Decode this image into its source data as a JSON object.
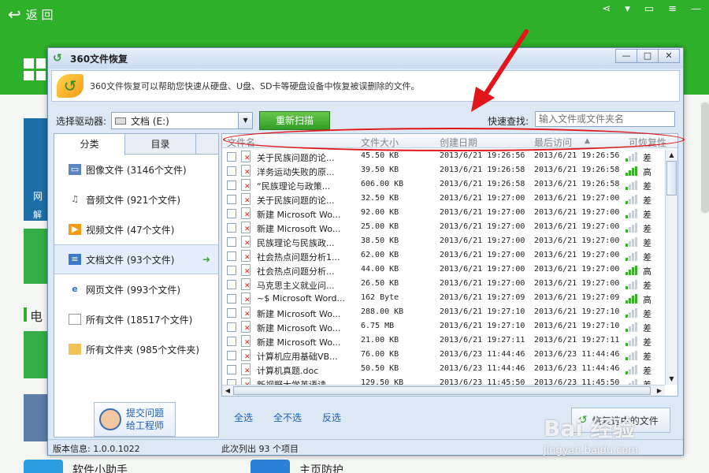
{
  "bg": {
    "back_label": "返 回",
    "tile_wang": "网",
    "tile_jie": "解",
    "section_dian": "电",
    "bottom_items": [
      "软件小助手",
      "主页防护"
    ],
    "top_icons": [
      "share-icon",
      "skin-icon",
      "message-icon",
      "menu-icon",
      "minimize-icon"
    ]
  },
  "dialog": {
    "title": "360文件恢复",
    "window_buttons": [
      "—",
      "□",
      "✕"
    ],
    "info_text": "360文件恢复可以帮助您快速从硬盘、U盘、SD卡等硬盘设备中恢复被误删除的文件。",
    "drive_label": "选择驱动器:",
    "drive_value": "文档 (E:)",
    "rescan_label": "重新扫描",
    "search_label": "快速查找:",
    "search_placeholder": "输入文件或文件夹名",
    "tabs": [
      "分类",
      "目录"
    ],
    "categories": [
      {
        "label": "图像文件 (3146个文件)",
        "icon": "image-file-icon"
      },
      {
        "label": "音频文件 (921个文件)",
        "icon": "audio-file-icon"
      },
      {
        "label": "视频文件 (47个文件)",
        "icon": "video-file-icon"
      },
      {
        "label": "文档文件 (93个文件)",
        "icon": "document-file-icon"
      },
      {
        "label": "网页文件 (993个文件)",
        "icon": "web-file-icon"
      },
      {
        "label": "所有文件 (18517个文件)",
        "icon": "all-files-icon"
      },
      {
        "label": "所有文件夹 (985个文件夹)",
        "icon": "folder-icon"
      }
    ],
    "help_line1": "提交问题",
    "help_line2": "给工程师",
    "columns": {
      "name": "文件名",
      "size": "文件大小",
      "created": "创建日期",
      "accessed": "最后访问",
      "sort_mark": "▲",
      "recoverable": "可恢复性"
    },
    "files": [
      {
        "name": "关于民族问题的论...",
        "size": "45.50 KB",
        "created": "2013/6/21 19:26:56",
        "accessed": "2013/6/21 19:26:56",
        "rec": "差"
      },
      {
        "name": "洋务运动失败的原...",
        "size": "39.50 KB",
        "created": "2013/6/21 19:26:58",
        "accessed": "2013/6/21 19:26:58",
        "rec": "高"
      },
      {
        "name": "“民族理论与政策...",
        "size": "606.00 KB",
        "created": "2013/6/21 19:26:58",
        "accessed": "2013/6/21 19:26:58",
        "rec": "差"
      },
      {
        "name": "关于民族问题的论...",
        "size": "32.50 KB",
        "created": "2013/6/21 19:27:00",
        "accessed": "2013/6/21 19:27:00",
        "rec": "差"
      },
      {
        "name": "新建 Microsoft Wo...",
        "size": "92.00 KB",
        "created": "2013/6/21 19:27:00",
        "accessed": "2013/6/21 19:27:00",
        "rec": "差"
      },
      {
        "name": "新建 Microsoft Wo...",
        "size": "25.00 KB",
        "created": "2013/6/21 19:27:00",
        "accessed": "2013/6/21 19:27:00",
        "rec": "差"
      },
      {
        "name": "民族理论与民族政...",
        "size": "38.50 KB",
        "created": "2013/6/21 19:27:00",
        "accessed": "2013/6/21 19:27:00",
        "rec": "差"
      },
      {
        "name": "社会热点问题分析1...",
        "size": "62.00 KB",
        "created": "2013/6/21 19:27:00",
        "accessed": "2013/6/21 19:27:00",
        "rec": "差"
      },
      {
        "name": "社会热点问题分析...",
        "size": "44.00 KB",
        "created": "2013/6/21 19:27:00",
        "accessed": "2013/6/21 19:27:00",
        "rec": "高"
      },
      {
        "name": "马克思主义就业问...",
        "size": "26.50 KB",
        "created": "2013/6/21 19:27:00",
        "accessed": "2013/6/21 19:27:00",
        "rec": "差"
      },
      {
        "name": "~$ Microsoft Word...",
        "size": "162 Byte",
        "created": "2013/6/21 19:27:09",
        "accessed": "2013/6/21 19:27:09",
        "rec": "高"
      },
      {
        "name": "新建 Microsoft Wo...",
        "size": "288.00 KB",
        "created": "2013/6/21 19:27:10",
        "accessed": "2013/6/21 19:27:10",
        "rec": "差"
      },
      {
        "name": "新建 Microsoft Wo...",
        "size": "6.75 MB",
        "created": "2013/6/21 19:27:10",
        "accessed": "2013/6/21 19:27:10",
        "rec": "差"
      },
      {
        "name": "新建 Microsoft Wo...",
        "size": "21.00 KB",
        "created": "2013/6/21 19:27:11",
        "accessed": "2013/6/21 19:27:11",
        "rec": "差"
      },
      {
        "name": "计算机应用基础VB...",
        "size": "76.00 KB",
        "created": "2013/6/23 11:44:46",
        "accessed": "2013/6/23 11:44:46",
        "rec": "差"
      },
      {
        "name": "计算机真题.doc",
        "size": "50.50 KB",
        "created": "2013/6/23 11:44:46",
        "accessed": "2013/6/23 11:44:46",
        "rec": "差"
      },
      {
        "name": "新视野大学英语读...",
        "size": "129.50 KB",
        "created": "2013/6/23 11:45:50",
        "accessed": "2013/6/23 11:45:50",
        "rec": "差"
      }
    ],
    "select_all": "全选",
    "select_none": "全不选",
    "invert": "反选",
    "recover_label": "恢复选中的文件",
    "version": "版本信息: 1.0.0.1022",
    "listed": "此次列出 93 个项目"
  },
  "watermark": {
    "main": "Bai 经验",
    "sub": "jingyan.baidu.com"
  },
  "colors": {
    "header_green": "#2fb02a",
    "annotation_red": "#e2161a",
    "good_bar": "#3cae2c",
    "poor_bar": "#3cae2c"
  }
}
